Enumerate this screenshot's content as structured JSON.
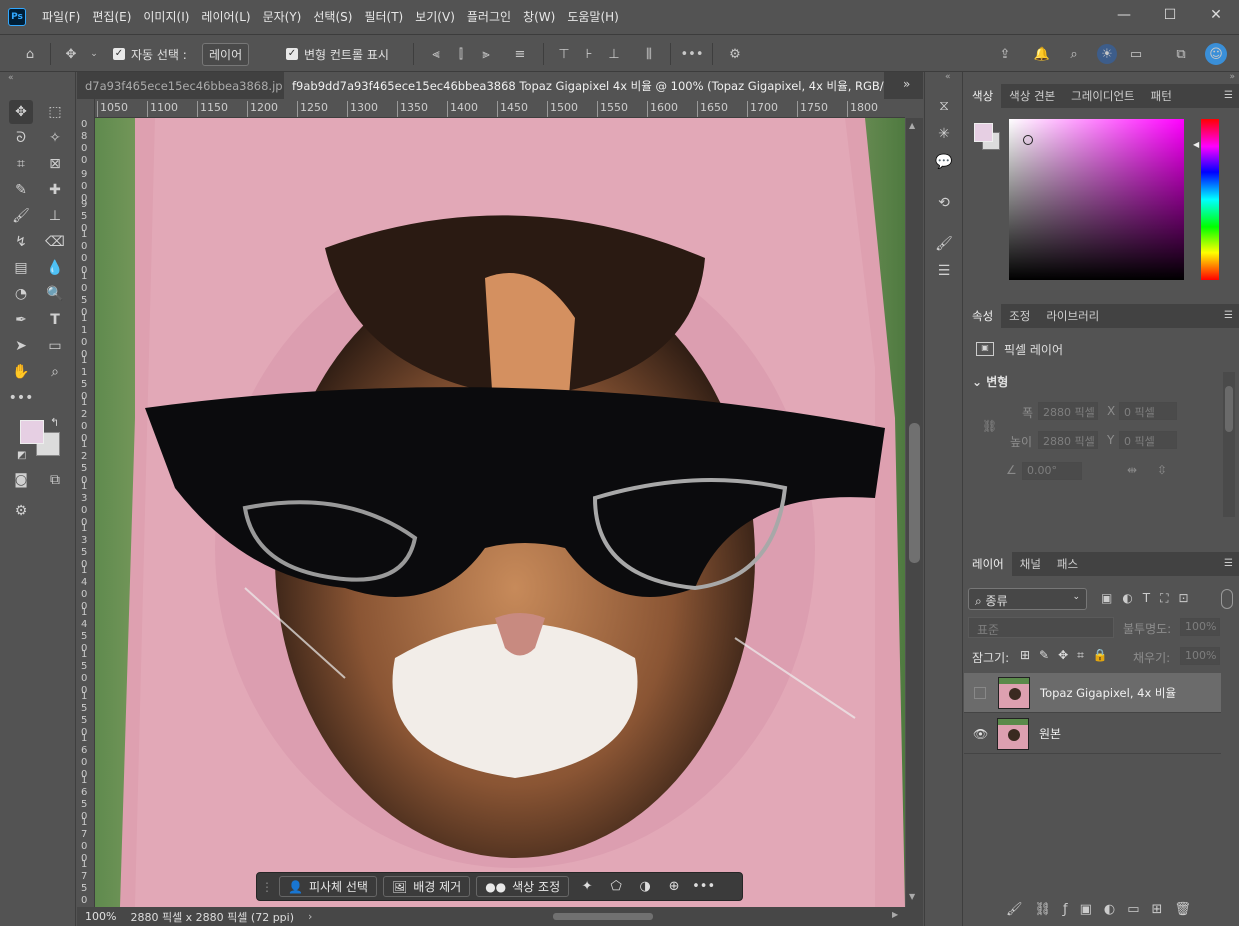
{
  "app": {
    "logo": "Ps"
  },
  "menu": [
    "파일(F)",
    "편집(E)",
    "이미지(I)",
    "레이어(L)",
    "문자(Y)",
    "선택(S)",
    "필터(T)",
    "보기(V)",
    "플러그인",
    "창(W)",
    "도움말(H)"
  ],
  "window_controls": {
    "minimize": "—",
    "maximize": "☐",
    "close": "✕"
  },
  "options": {
    "auto_select_label": "자동 선택 :",
    "auto_select_value": "레이어",
    "transform_label": "변형 컨트롤 표시"
  },
  "tabs": [
    {
      "label": "d7a93f465ece15ec46bbea3868.jpg",
      "close": "×"
    },
    {
      "label": "f9ab9dd7a93f465ece15ec46bbea3868 Topaz Gigapixel 4x 비율 @ 100% (Topaz Gigapixel, 4x 비율, RGB/8) *",
      "close": "×"
    }
  ],
  "ruler_h": [
    "1050",
    "1100",
    "1150",
    "1200",
    "1250",
    "1300",
    "1350",
    "1400",
    "1450",
    "1500",
    "1550",
    "1600",
    "1650",
    "1700",
    "1750",
    "1800"
  ],
  "ruler_v": [
    "0",
    "0",
    "0",
    "0",
    "0",
    "0",
    "0",
    "0",
    "0",
    "0",
    "0",
    "0",
    "1",
    "1",
    "1",
    "1",
    "1",
    "1",
    "1",
    "1",
    "1",
    "1",
    "1",
    "1",
    "1",
    "1",
    "1",
    "1",
    "1",
    "1",
    "1",
    "1",
    "1",
    "1",
    "1",
    "1",
    "1",
    "1",
    "1",
    "1",
    "1",
    "1",
    "1",
    "1",
    "1",
    "1",
    "1",
    "1",
    "1",
    "1",
    "1",
    "1",
    "1",
    "1",
    "1",
    "1",
    "1",
    "1",
    "1",
    "1",
    "1",
    "1",
    "1",
    "1"
  ],
  "ruler_v_labels": [
    [
      "0",
      "8",
      "0",
      "0"
    ],
    [
      "9",
      "0",
      "0"
    ],
    [
      "9",
      "5",
      "0"
    ],
    [
      "1",
      "0",
      "0",
      "0"
    ],
    [
      "1",
      "0",
      "5",
      "0"
    ],
    [
      "1",
      "1",
      "0",
      "0"
    ],
    [
      "1",
      "1",
      "5",
      "0"
    ],
    [
      "1",
      "2",
      "0",
      "0"
    ],
    [
      "1",
      "2",
      "5",
      "0"
    ],
    [
      "1",
      "3",
      "0",
      "0"
    ],
    [
      "1",
      "3",
      "5",
      "0"
    ],
    [
      "1",
      "4",
      "0",
      "0"
    ],
    [
      "1",
      "4",
      "5",
      "0"
    ],
    [
      "1",
      "5",
      "0",
      "0"
    ],
    [
      "1",
      "5",
      "5",
      "0"
    ],
    [
      "1",
      "6",
      "0",
      "0"
    ],
    [
      "1",
      "6",
      "5",
      "0"
    ],
    [
      "1",
      "7",
      "0",
      "0"
    ],
    [
      "1",
      "7",
      "5",
      "0"
    ]
  ],
  "status": {
    "zoom": "100%",
    "doc_info": "2880 픽셀 x 2880 픽셀 (72 ppi)"
  },
  "context_bar": {
    "select_subject": "피사체 선택",
    "remove_bg": "배경 제거",
    "color_adjust": "색상 조정"
  },
  "color_panel": {
    "tabs": [
      "색상",
      "색상 견본",
      "그레이디언트",
      "패턴"
    ],
    "fg": "#e6cfe3",
    "bg": "#dcdcdc"
  },
  "props_panel": {
    "tabs": [
      "속성",
      "조정",
      "라이브러리"
    ],
    "layer_type": "픽셀 레이어",
    "section": "변형",
    "width_label": "폭",
    "width": "2880 픽셀",
    "height_label": "높이",
    "height": "2880 픽셀",
    "x_label": "X",
    "x": "0 픽셀",
    "y_label": "Y",
    "y": "0 픽셀",
    "angle": "0.00°"
  },
  "layers_panel": {
    "tabs": [
      "레이어",
      "채널",
      "패스"
    ],
    "filter": "종류",
    "blend": "표준",
    "opacity_label": "불투명도:",
    "opacity": "100%",
    "lock_label": "잠그기:",
    "fill_label": "채우기:",
    "fill": "100%",
    "layers": [
      {
        "name": "Topaz Gigapixel, 4x 비율",
        "visible": false,
        "selected": true
      },
      {
        "name": "원본",
        "visible": true,
        "selected": false
      }
    ]
  }
}
